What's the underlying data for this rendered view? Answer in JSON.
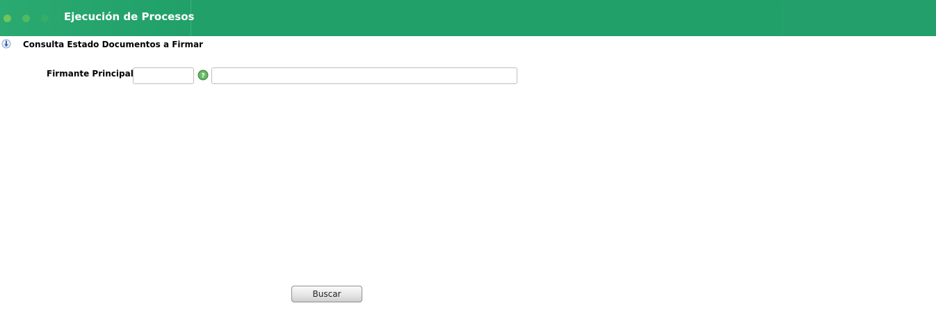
{
  "header": {
    "title": "Ejecución de Procesos",
    "background_color": "#21a06a",
    "dot_colors": [
      "#6fc65a",
      "#52b963",
      "#35ad66"
    ]
  },
  "section": {
    "title": "Consulta Estado Documentos a Firmar",
    "icon": "info-arrow-icon"
  },
  "form": {
    "firmante_label": "Firmante Principal:",
    "firmante_code_value": "",
    "firmante_name_value": "",
    "help_icon": "help-question-icon"
  },
  "actions": {
    "buscar_label": "Buscar"
  }
}
